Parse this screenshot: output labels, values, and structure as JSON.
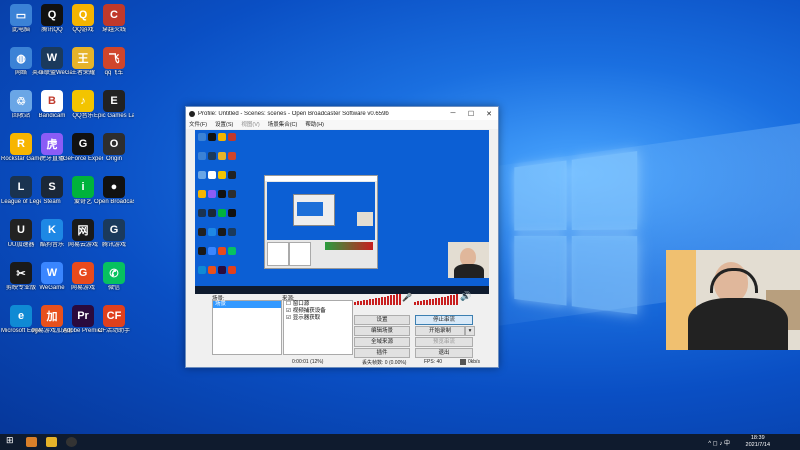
{
  "obs": {
    "title": "Profile: Untitled - Scenes: scenes - Open Broadcaster Software v0.659b",
    "menu": [
      "文件(F)",
      "设置(S)",
      "视图(V)",
      "场景集合(C)",
      "帮助(H)"
    ],
    "scenes_label": "场景:",
    "scene_item": "场景",
    "sources_label": "来源:",
    "sources": [
      "窗口源",
      "视频捕获设备",
      "显示器获取"
    ],
    "buttons": {
      "settings": "设置",
      "stop_stream": "停止串流",
      "edit_scene": "编辑场景",
      "start_record": "开始录制",
      "global_sources": "全域来源",
      "preview_stream": "预览串流",
      "plugins": "插件",
      "exit": "退出"
    },
    "status": {
      "time": "0:00:01 (12%)",
      "dropped": "丢失帧数: 0 (0.00%)",
      "fps": "FPS: 40",
      "rate": "0kb/s"
    }
  },
  "desktop_icons": [
    {
      "label": "此电脑",
      "color": "#3b82d6",
      "glyph": "▭"
    },
    {
      "label": "腾讯QQ",
      "color": "#111111",
      "glyph": "Q"
    },
    {
      "label": "QQ游戏",
      "color": "#f5b400",
      "glyph": "Q"
    },
    {
      "label": "穿越火线",
      "color": "#c0392b",
      "glyph": "C"
    },
    {
      "label": "网络",
      "color": "#3b82d6",
      "glyph": "◍"
    },
    {
      "label": "英雄联盟WeGame版",
      "color": "#1b3a5c",
      "glyph": "W"
    },
    {
      "label": "王者荣耀",
      "color": "#e6b32a",
      "glyph": "王"
    },
    {
      "label": "qq飞车",
      "color": "#d0452b",
      "glyph": "飞"
    },
    {
      "label": "回收站",
      "color": "#6aa6e6",
      "glyph": "♲"
    },
    {
      "label": "Bandicam",
      "color": "#ffffff",
      "glyph": "B"
    },
    {
      "label": "QQ音乐",
      "color": "#f3c400",
      "glyph": "♪"
    },
    {
      "label": "Epic Games Launcher",
      "color": "#222222",
      "glyph": "E"
    },
    {
      "label": "Rockstar Games",
      "color": "#f7b500",
      "glyph": "R"
    },
    {
      "label": "虎牙直播",
      "color": "#8b5cf6",
      "glyph": "虎"
    },
    {
      "label": "GeForce Experience",
      "color": "#111111",
      "glyph": "G"
    },
    {
      "label": "Origin",
      "color": "#2e2e2e",
      "glyph": "O"
    },
    {
      "label": "League of Legends",
      "color": "#1a3350",
      "glyph": "L"
    },
    {
      "label": "Steam",
      "color": "#1b2838",
      "glyph": "S"
    },
    {
      "label": "爱奇艺",
      "color": "#00b33c",
      "glyph": "i"
    },
    {
      "label": "Open Broadcaster",
      "color": "#111111",
      "glyph": "●"
    },
    {
      "label": "UU加速器",
      "color": "#222222",
      "glyph": "U"
    },
    {
      "label": "酷狗音乐",
      "color": "#1e88e5",
      "glyph": "K"
    },
    {
      "label": "网易云游戏",
      "color": "#1a1a1a",
      "glyph": "网"
    },
    {
      "label": "腾讯游戏",
      "color": "#1b3a5c",
      "glyph": "G"
    },
    {
      "label": "剪映专业版",
      "color": "#1a1a1a",
      "glyph": "✂"
    },
    {
      "label": "WeGame",
      "color": "#3a86ff",
      "glyph": "W"
    },
    {
      "label": "网易游戏",
      "color": "#e84a1c",
      "glyph": "G"
    },
    {
      "label": "微信",
      "color": "#07c160",
      "glyph": "✆"
    },
    {
      "label": "Microsoft Edge",
      "color": "#0f8ad4",
      "glyph": "e"
    },
    {
      "label": "网易游戏加速器",
      "color": "#e8501c",
      "glyph": "加"
    },
    {
      "label": "Adobe Premiere",
      "color": "#2a0a3d",
      "glyph": "Pr"
    },
    {
      "label": "CF活动助手",
      "color": "#e0401c",
      "glyph": "CF"
    }
  ],
  "taskbar": {
    "time": "18:39",
    "date": "2021/7/14",
    "lang": "中",
    "tray": "^ ◻ ♪ 中"
  }
}
